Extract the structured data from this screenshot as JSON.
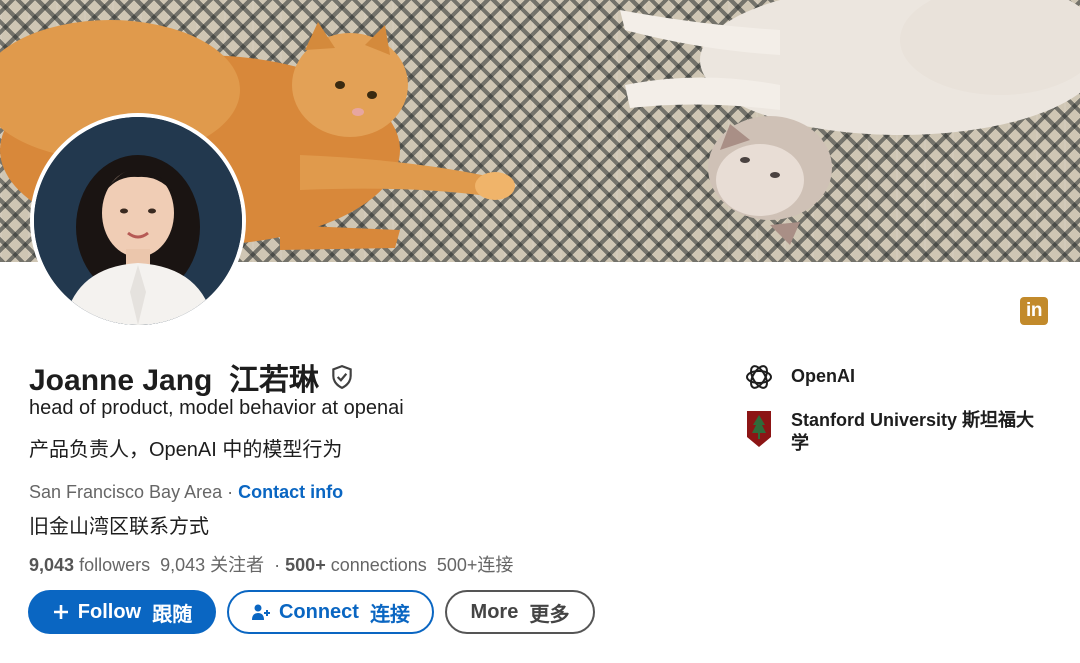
{
  "profile": {
    "name": "Joanne Jang",
    "name_zh": "江若琳",
    "headline": "head of product, model behavior at openai",
    "headline_zh": "产品负责人，OpenAI 中的模型行为",
    "location": "San Francisco Bay Area",
    "location_sep": " · ",
    "contact_info": "Contact info",
    "location_zh": "旧金山湾区联系方式",
    "followers_count": "9,043",
    "followers_label": "followers",
    "followers_zh": "9,043 关注者",
    "connections_count": "500+",
    "connections_label": "connections",
    "connections_zh": "500+连接"
  },
  "actions": {
    "follow": "Follow",
    "follow_zh": "跟随",
    "connect": "Connect",
    "connect_zh": "连接",
    "more": "More",
    "more_zh": "更多"
  },
  "orgs": [
    {
      "name": "OpenAI",
      "icon": "openai-logo-icon"
    },
    {
      "name": "Stanford University  斯坦福大学",
      "icon": "stanford-logo-icon"
    }
  ],
  "badge": {
    "text": "in",
    "icon": "linkedin-icon"
  },
  "colors": {
    "brand_blue": "#0a66c2",
    "badge_gold": "#c28a2b",
    "stanford_red": "#8c1515"
  }
}
